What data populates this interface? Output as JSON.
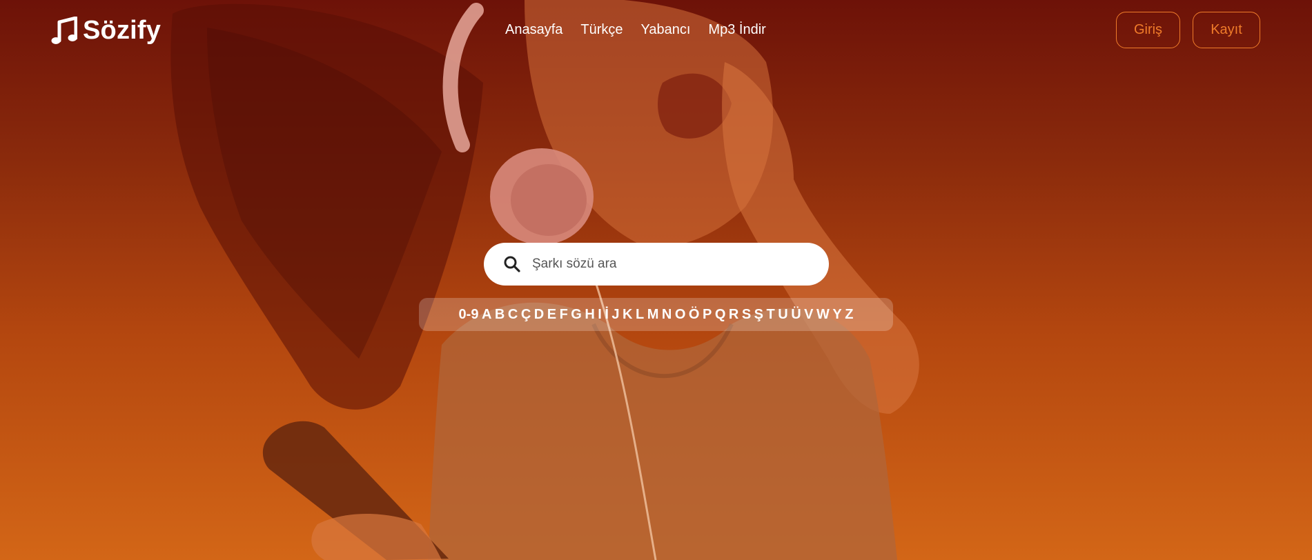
{
  "brand": {
    "name": "Sözify",
    "icon": "music-note-icon"
  },
  "nav": {
    "items": [
      {
        "label": "Anasayfa"
      },
      {
        "label": "Türkçe"
      },
      {
        "label": "Yabancı"
      },
      {
        "label": "Mp3 İndir"
      }
    ]
  },
  "auth": {
    "login_label": "Giriş",
    "register_label": "Kayıt",
    "accent": "#f07c2a"
  },
  "search": {
    "placeholder": "Şarkı sözü ara",
    "value": "",
    "icon": "search-icon"
  },
  "alphabet": [
    "0-9",
    "A",
    "B",
    "C",
    "Ç",
    "D",
    "E",
    "F",
    "G",
    "H",
    "I",
    "İ",
    "J",
    "K",
    "L",
    "M",
    "N",
    "O",
    "Ö",
    "P",
    "Q",
    "R",
    "S",
    "Ş",
    "T",
    "U",
    "Ü",
    "V",
    "W",
    "Y",
    "Z"
  ],
  "colors": {
    "gradient_top": "#6d1208",
    "gradient_bottom": "#d36617",
    "text": "#ffffff"
  }
}
